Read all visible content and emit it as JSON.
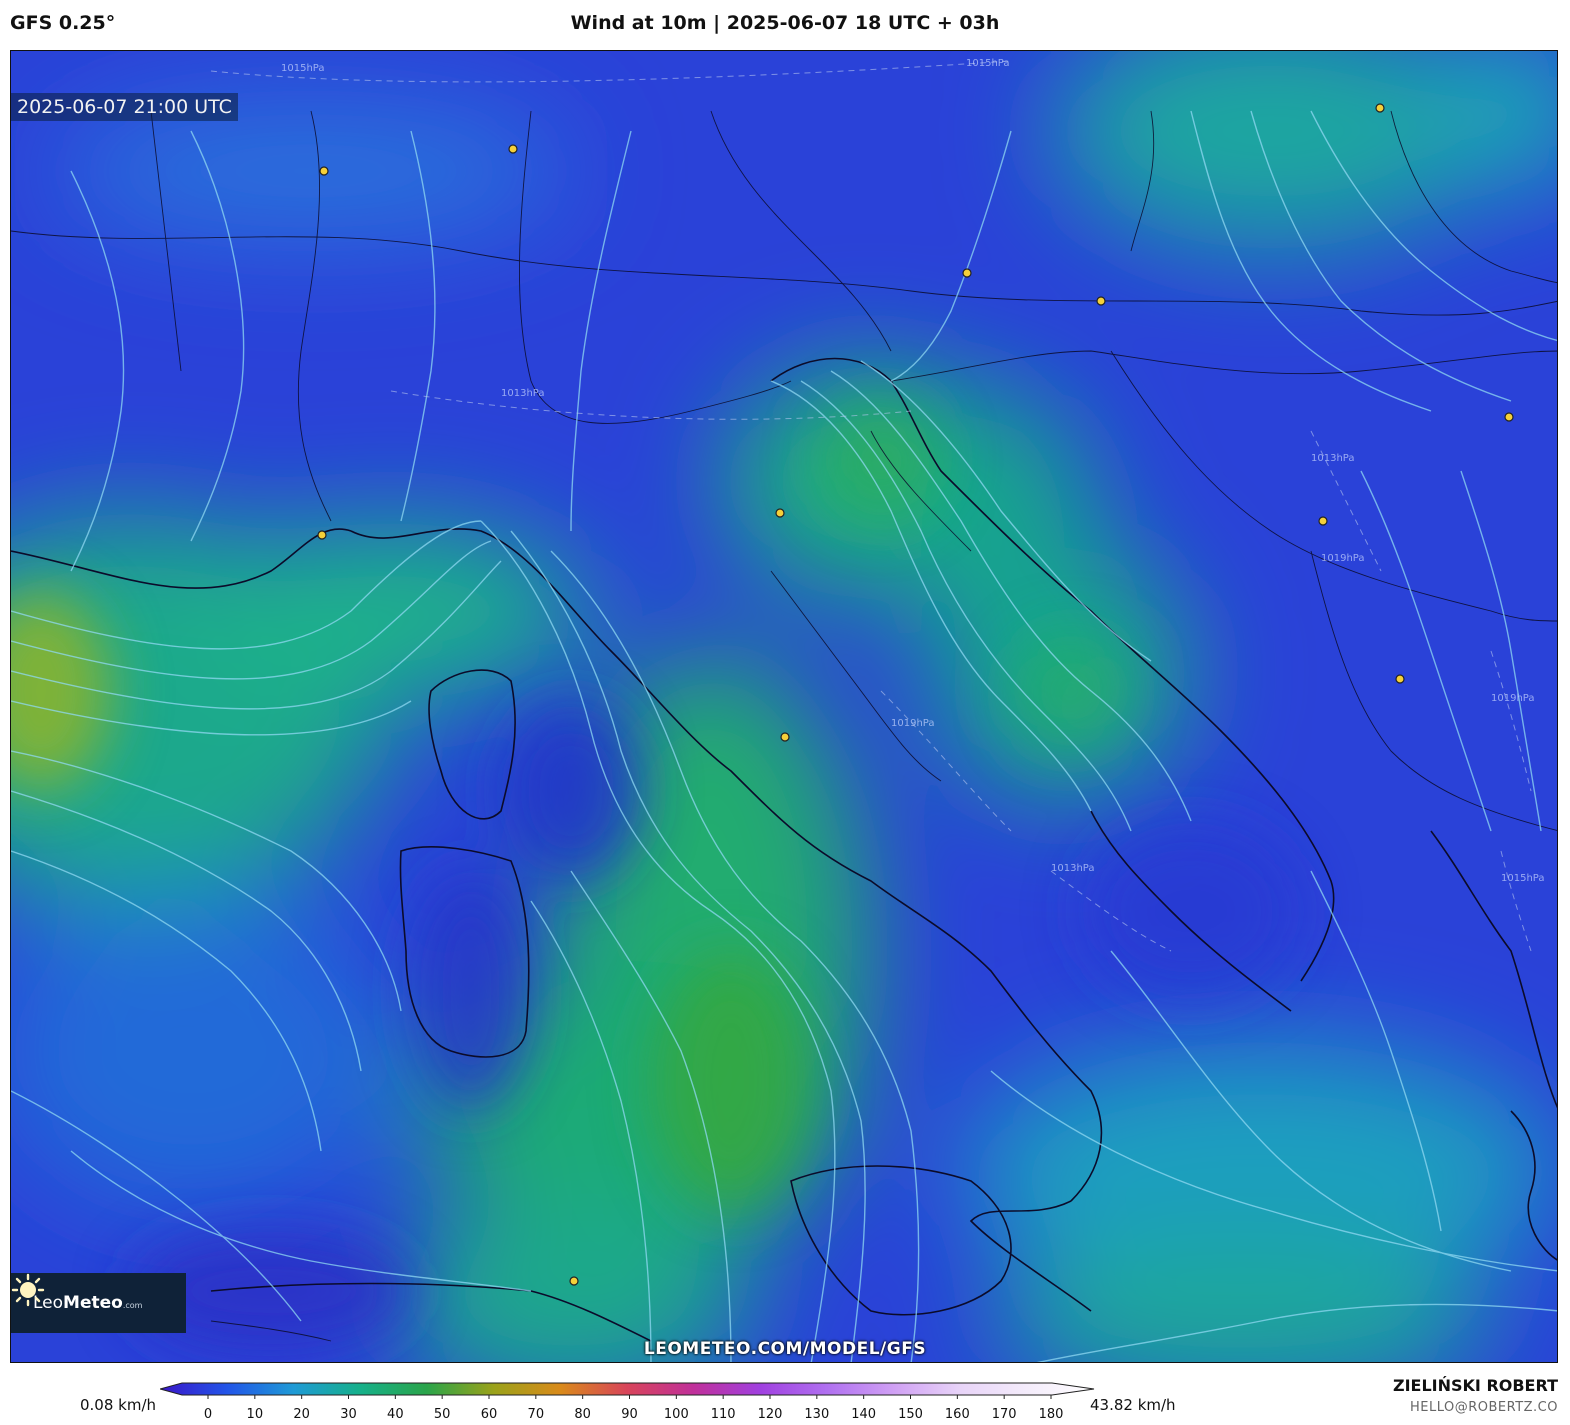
{
  "header": {
    "model": "GFS 0.25°",
    "title": "Wind at 10m | 2025-06-07 18 UTC + 03h"
  },
  "map": {
    "valid_time": "2025-06-07 21:00 UTC",
    "isobar_labels": [
      "1015hPa",
      "1013hPa",
      "1013hPa",
      "1019hPa",
      "1015hPa",
      "1019hPa",
      "1013hPa",
      "1015hPa",
      "1019hPa"
    ],
    "source_url": "LEOMETEO.COM/MODEL/GFS",
    "brand": {
      "name_a": "Leo",
      "name_b": "Meteo",
      "suffix": ".com",
      "icon": "sun-icon"
    }
  },
  "colorbar": {
    "unit": "km/h",
    "min_label": "0.08 km/h",
    "max_label": "43.82 km/h",
    "ticks": [
      "0",
      "10",
      "20",
      "30",
      "40",
      "50",
      "60",
      "70",
      "80",
      "90",
      "100",
      "110",
      "120",
      "130",
      "140",
      "150",
      "160",
      "170",
      "180"
    ],
    "stops": [
      "#3a16c8",
      "#2254e8",
      "#1f9ad6",
      "#16b08a",
      "#2aa44a",
      "#9aa21a",
      "#d98a1a",
      "#d8445a",
      "#c0309a",
      "#a040e0",
      "#b070f0",
      "#d0a0f4",
      "#e8d4f8",
      "#f4ecfb",
      "#ffffff"
    ]
  },
  "credits": {
    "author": "ZIELIŃSKI ROBERT",
    "email": "HELLO@ROBERTZ.CO"
  },
  "colors": {
    "calm_wind": "#2b3fd6",
    "moderate_wind": "#1fb08f",
    "strong_wind": "#2fae4a",
    "streamline": "#8fd8f2",
    "city_marker": "#f5d03a"
  }
}
